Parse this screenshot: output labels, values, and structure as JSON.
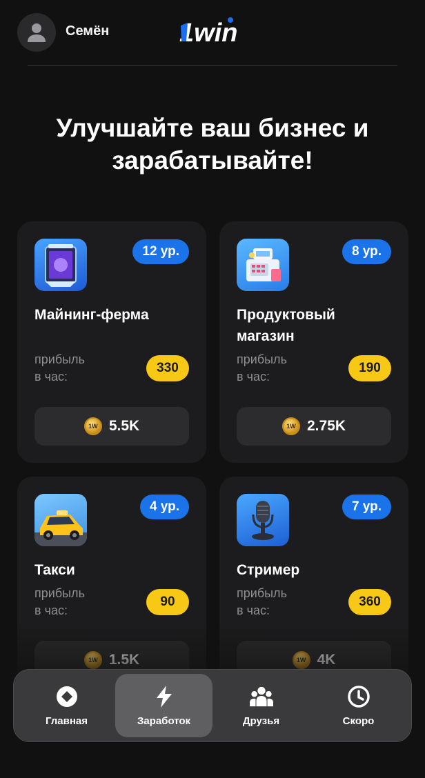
{
  "header": {
    "username": "Семён",
    "logo_text": "1win"
  },
  "headline": {
    "line1": "Улучшайте ваш бизнес и",
    "line2": "зарабатывайте!"
  },
  "cards": [
    {
      "title_line1": "Майнинг-ферма",
      "title_line2": "",
      "level": "12 ур.",
      "profit_label_line1": "прибыль",
      "profit_label_line2": "в час:",
      "profit": "330",
      "cost": "5.5K",
      "image_icon": "mining-rig-icon"
    },
    {
      "title_line1": "Продуктовый",
      "title_line2": "магазин",
      "level": "8 ур.",
      "profit_label_line1": "прибыль",
      "profit_label_line2": "в час:",
      "profit": "190",
      "cost": "2.75K",
      "image_icon": "cash-register-icon"
    },
    {
      "title_line1": "Такси",
      "title_line2": "",
      "level": "4 ур.",
      "profit_label_line1": "прибыль",
      "profit_label_line2": "в час:",
      "profit": "90",
      "cost": "1.5K",
      "image_icon": "taxi-icon"
    },
    {
      "title_line1": "Стример",
      "title_line2": "",
      "level": "7 ур.",
      "profit_label_line1": "прибыль",
      "profit_label_line2": "в час:",
      "profit": "360",
      "cost": "4K",
      "image_icon": "microphone-icon"
    }
  ],
  "nav": {
    "items": [
      {
        "label": "Главная",
        "icon": "home-diamond-icon",
        "active": false
      },
      {
        "label": "Заработок",
        "icon": "lightning-icon",
        "active": true
      },
      {
        "label": "Друзья",
        "icon": "friends-icon",
        "active": false
      },
      {
        "label": "Скоро",
        "icon": "clock-icon",
        "active": false
      }
    ]
  },
  "colors": {
    "background": "#111111",
    "card": "#1c1c1e",
    "level_badge": "#1a73e8",
    "profit_badge": "#f7c815",
    "nav_active": "#5f5f62"
  }
}
